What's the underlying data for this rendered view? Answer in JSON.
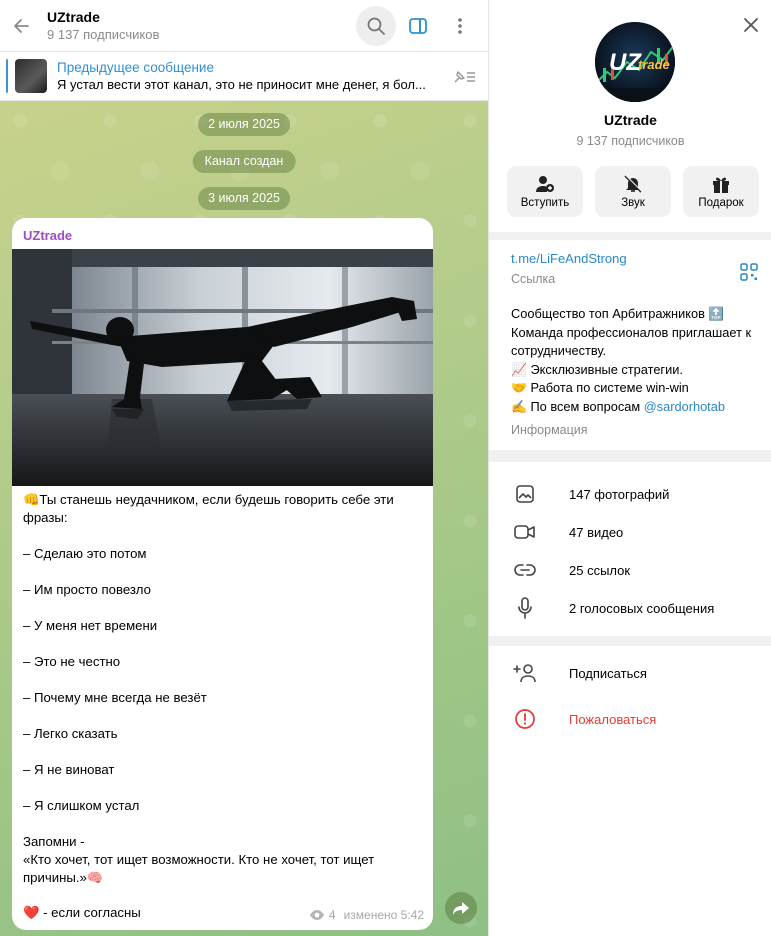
{
  "chat": {
    "title": "UZtrade",
    "subscribers": "9 137 подписчиков",
    "pinned": {
      "title": "Предыдущее сообщение",
      "snippet": "Я устал вести этот канал, это не приносит мне денег, я бол..."
    },
    "dates": [
      "2 июля 2025",
      "Канал создан",
      "3 июля 2025"
    ],
    "message": {
      "author": "UZtrade",
      "lines": [
        "👊Ты станешь неудачником, если будешь говорить себе эти",
        "фразы:",
        "",
        "– Сделаю это потом",
        "",
        "– Им просто повезло",
        "",
        "– У меня нет времени",
        "",
        "– Это не честно",
        "",
        "– Почему мне всегда не везёт",
        "",
        "– Легко сказать",
        "",
        "– Я не виноват",
        "",
        "– Я слишком устал",
        "",
        "Запомни -",
        "«Кто хочет, тот ищет возможности. Кто не хочет, тот ищет",
        "причины.»🧠"
      ],
      "footer": "❤️ - если согласны",
      "views": "4",
      "edited": "изменено 5:42"
    }
  },
  "info": {
    "name": "UZtrade",
    "subscribers": "9 137 подписчиков",
    "avatar_text": "UZtrade",
    "actions": [
      {
        "label": "Вступить",
        "icon": "join-icon"
      },
      {
        "label": "Звук",
        "icon": "mute-icon"
      },
      {
        "label": "Подарок",
        "icon": "gift-icon"
      }
    ],
    "link": "t.me/LiFeAndStrong",
    "link_caption": "Ссылка",
    "about_lines": [
      "Сообщество топ Арбитражников 🔝",
      "Команда профессионалов приглашает к",
      "сотрудничеству.",
      "📈 Эксклюзивные стратегии.",
      "🤝 Работа по системе win-win",
      "✍️ По всем вопросам "
    ],
    "about_mention": "@sardorhotab",
    "about_caption": "Информация",
    "media": [
      {
        "label": "147 фотографий",
        "icon": "photo-icon"
      },
      {
        "label": "47 видео",
        "icon": "video-icon"
      },
      {
        "label": "25 ссылок",
        "icon": "link-icon"
      },
      {
        "label": "2 голосовых сообщения",
        "icon": "mic-icon"
      }
    ],
    "bottom_actions": [
      {
        "label": "Подписаться",
        "icon": "subscribe-icon"
      },
      {
        "label": "Пожаловаться",
        "icon": "report-icon"
      }
    ]
  },
  "colors": {
    "accent": "#2f8fd4",
    "author": "#9c4cc4",
    "danger": "#e53935"
  }
}
